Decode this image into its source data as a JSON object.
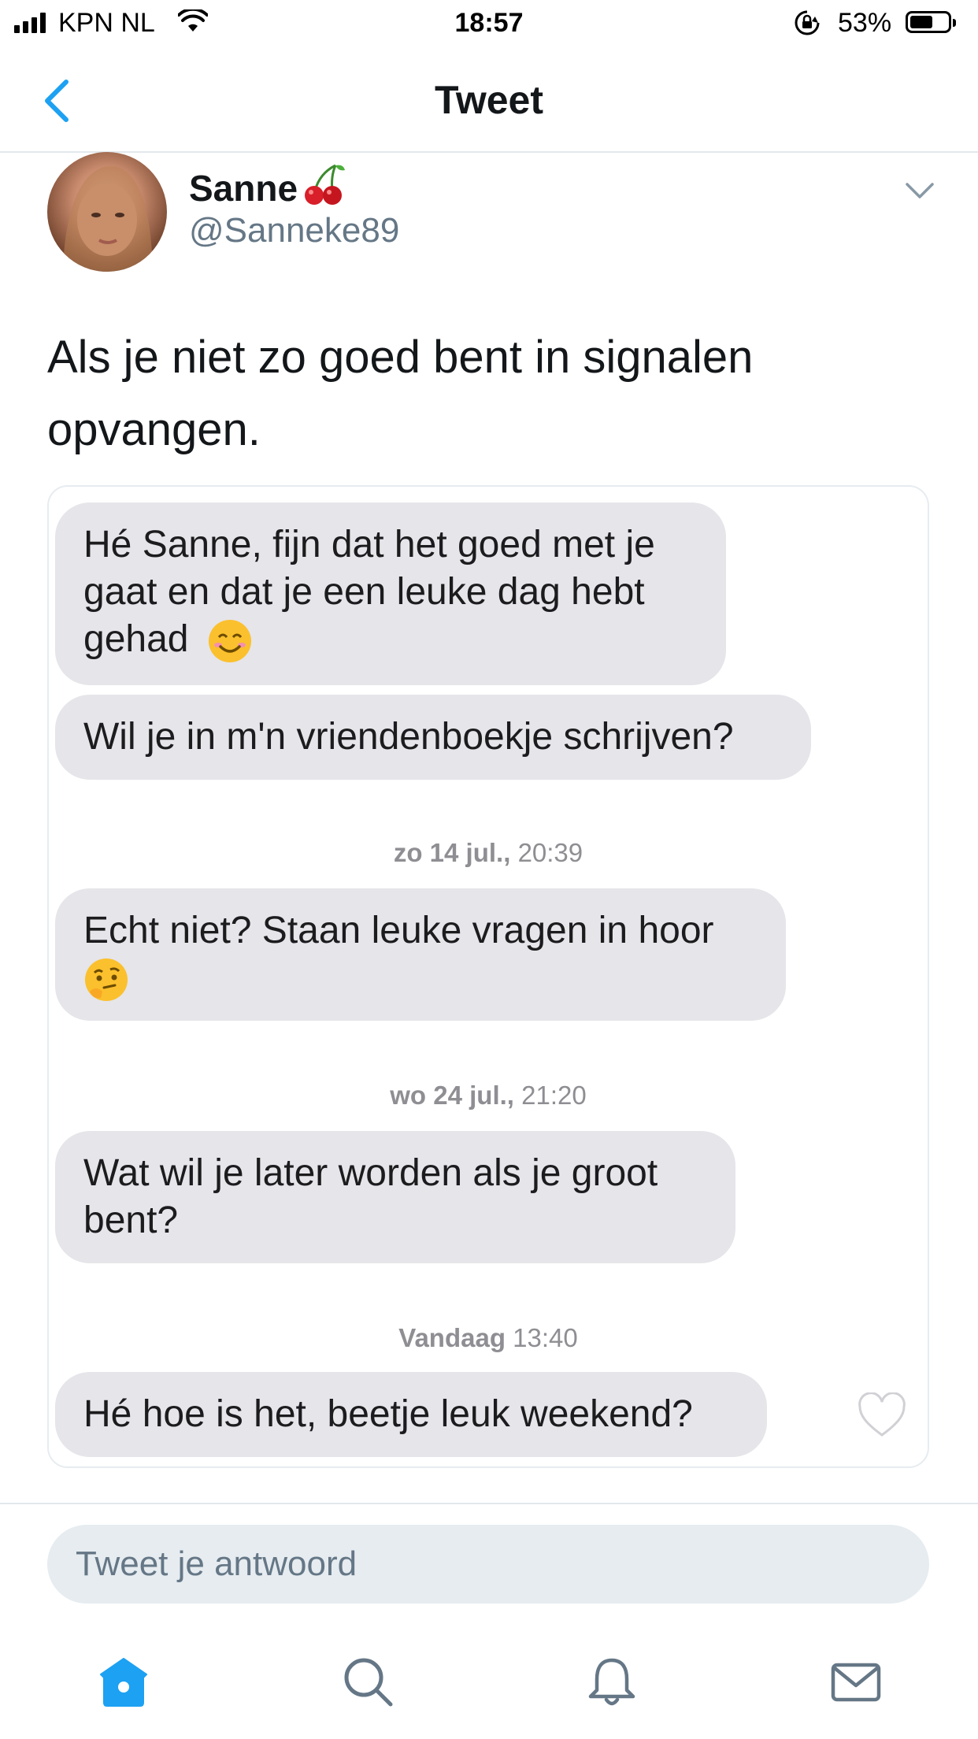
{
  "status_bar": {
    "carrier": "KPN NL",
    "time": "18:57",
    "battery": "53%"
  },
  "nav": {
    "title": "Tweet"
  },
  "tweet": {
    "display_name": "Sanne",
    "handle": "@Sanneke89",
    "text": "Als je niet zo goed bent in signalen opvangen."
  },
  "conversation": {
    "messages": [
      {
        "text": "Hé Sanne, fijn dat het goed met je gaat en dat je een leuke dag hebt gehad",
        "emoji": "smiling-face"
      },
      {
        "text": "Wil je in m'n vriendenboekje schrijven?"
      },
      {
        "text": "Echt niet? Staan leuke vragen in hoor",
        "emoji": "thinking-face"
      },
      {
        "text": "Wat wil je later worden als je groot bent?"
      },
      {
        "text": "Hé hoe is het, beetje leuk weekend?"
      }
    ],
    "timestamps": [
      {
        "day": "zo 14 jul.,",
        "time": "20:39"
      },
      {
        "day": "wo 24 jul.,",
        "time": "21:20"
      },
      {
        "day": "Vandaag",
        "time": "13:40"
      }
    ]
  },
  "reply": {
    "placeholder": "Tweet je antwoord"
  },
  "tabs": [
    "home-icon",
    "search-icon",
    "notifications-icon",
    "messages-icon"
  ],
  "colors": {
    "accent": "#1da1f2",
    "bubble": "#e5e5ea",
    "muted": "#657786"
  }
}
